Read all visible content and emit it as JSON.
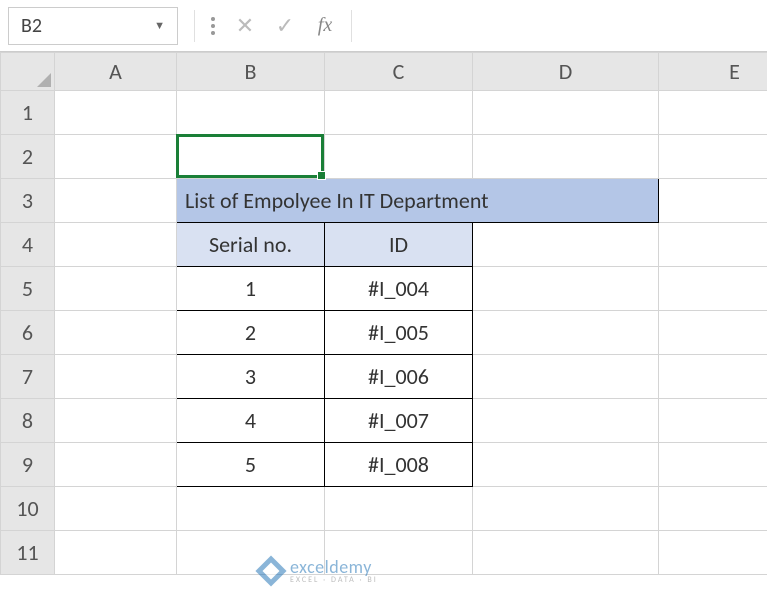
{
  "nameBox": {
    "value": "B2"
  },
  "formulaBarIcons": {
    "cancel": "✕",
    "confirm": "✓",
    "fx": "fx"
  },
  "formulaInput": {
    "value": ""
  },
  "columns": [
    "A",
    "B",
    "C",
    "D",
    "E"
  ],
  "rows": [
    "1",
    "2",
    "3",
    "4",
    "5",
    "6",
    "7",
    "8",
    "9",
    "10",
    "11"
  ],
  "dataTable": {
    "title": "List of Empolyee In IT Department",
    "headers": {
      "serial": "Serial no.",
      "id": "ID"
    },
    "rows": [
      {
        "serial": "1",
        "id": "#I_004"
      },
      {
        "serial": "2",
        "id": "#I_005"
      },
      {
        "serial": "3",
        "id": "#I_006"
      },
      {
        "serial": "4",
        "id": "#I_007"
      },
      {
        "serial": "5",
        "id": "#I_008"
      }
    ]
  },
  "watermark": {
    "brand": "exceldemy",
    "tag": "EXCEL · DATA · BI"
  }
}
